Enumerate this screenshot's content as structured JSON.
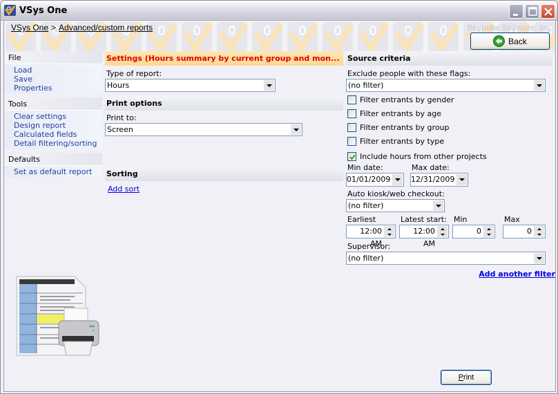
{
  "window": {
    "title": "VSys One",
    "icon": "vsys-logo-icon",
    "controls": [
      "minimize",
      "maximize",
      "close"
    ]
  },
  "banner": {
    "breadcrumb": [
      {
        "label": "VSys One"
      },
      {
        "label": "Advanced/custom reports"
      }
    ],
    "breadcrumb_separator": ">",
    "company": "Bespoke Software, Inc.",
    "back_button": {
      "label": "Back",
      "icon": "back-arrow-icon"
    }
  },
  "sidebar": {
    "groups": [
      {
        "title": "File",
        "items": [
          "Load",
          "Save",
          "Properties"
        ]
      },
      {
        "title": "Tools",
        "items": [
          "Clear settings",
          "Design report",
          "Calculated fields",
          "Detail filtering/sorting"
        ]
      },
      {
        "title": "Defaults",
        "items": [
          "Set as default report"
        ]
      }
    ],
    "image": "report-printer-illustration"
  },
  "settings": {
    "header": "Settings (Hours summary by current group and mon...",
    "type_of_report_label": "Type of report:",
    "type_of_report_value": "Hours",
    "print_options_header": "Print options",
    "print_to_label": "Print to:",
    "print_to_value": "Screen",
    "sorting_header": "Sorting",
    "add_sort": "Add sort"
  },
  "source_criteria": {
    "header": "Source criteria",
    "exclude_flags_label": "Exclude people with these flags:",
    "exclude_flags_value": "(no filter)",
    "filters": [
      {
        "label": "Filter entrants by gender",
        "checked": false
      },
      {
        "label": "Filter entrants by age",
        "checked": false
      },
      {
        "label": "Filter entrants by group",
        "checked": false
      },
      {
        "label": "Filter entrants by type",
        "checked": false
      }
    ],
    "include_other_projects": {
      "label": "Include hours from other projects",
      "checked": true
    },
    "min_date_label": "Min date:",
    "min_date_value": "01/01/2009",
    "max_date_label": "Max date:",
    "max_date_value": "12/31/2009",
    "kiosk_label": "Auto kiosk/web checkout:",
    "kiosk_value": "(no filter)",
    "earliest_start_label": "Earliest start:",
    "earliest_start_value": "12:00 AM",
    "latest_start_label": "Latest start:",
    "latest_start_value": "12:00 AM",
    "min_duration_label": "Min duration:",
    "min_duration_value": "0",
    "max_duration_label": "Max duration:",
    "max_duration_value": "0",
    "supervisor_label": "Supervisor:",
    "supervisor_value": "(no filter)",
    "add_filter": "Add another filter"
  },
  "footer": {
    "print_button": "Print"
  },
  "colors": {
    "settings_header_text": "#e00000",
    "settings_header_bg": "#fbd990",
    "link_blue": "#0000e0",
    "sidebar_link": "#1e3fa0",
    "close_button": "#c8452c"
  }
}
